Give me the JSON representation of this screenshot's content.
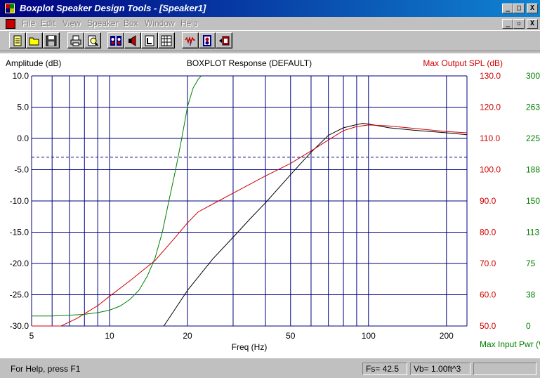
{
  "window": {
    "title": "Boxplot Speaker Design Tools - [Speaker1]",
    "controls": [
      "_",
      "□",
      "X"
    ],
    "doc_controls": [
      "_",
      "▫",
      "X"
    ]
  },
  "menu": [
    "File",
    "Edit",
    "View",
    "Speaker",
    "Box",
    "Window",
    "Help"
  ],
  "toolbar": [
    {
      "name": "new-icon"
    },
    {
      "name": "open-icon"
    },
    {
      "name": "save-icon"
    },
    {
      "name": "print-icon"
    },
    {
      "name": "print-preview-icon"
    },
    {
      "name": "speaker-params-icon"
    },
    {
      "name": "speaker-icon"
    },
    {
      "name": "box-icon"
    },
    {
      "name": "table-icon"
    },
    {
      "name": "response-icon"
    },
    {
      "name": "ports-icon"
    },
    {
      "name": "enclosure-icon"
    }
  ],
  "colors": {
    "grid": "#000080",
    "amplitude": "#000000",
    "spl": "#d00000",
    "power": "#008000",
    "ref_line": "#000080"
  },
  "status": {
    "help": "For Help, press F1",
    "fs": "Fs= 42.5",
    "vb": "Vb= 1.00ft^3",
    "extra": ""
  },
  "chart_data": {
    "type": "line",
    "title": "BOXPLOT Response (DEFAULT)",
    "xlabel": "Freq (Hz)",
    "ylabel": "Amplitude (dB)",
    "y2label": "Max Output SPL (dB)",
    "y3label": "Max Input Pwr (W",
    "xscale": "log",
    "xlim": [
      5,
      240
    ],
    "x_ticks": [
      5,
      10,
      20,
      50,
      100,
      200
    ],
    "x_ticklabels": [
      "5",
      "10",
      "20",
      "50",
      "100",
      "200"
    ],
    "x_gridlines": [
      5,
      6,
      7,
      8,
      9,
      10,
      20,
      30,
      40,
      50,
      60,
      70,
      80,
      90,
      100,
      200
    ],
    "ylim": [
      -30,
      10
    ],
    "y_ticks": [
      10,
      5,
      0,
      -5,
      -10,
      -15,
      -20,
      -25,
      -30
    ],
    "y_ticklabels": [
      "10.0",
      "5.0",
      "0.0",
      "-5.0",
      "-10.0",
      "-15.0",
      "-20.0",
      "-25.0",
      "-30.0"
    ],
    "y2_ticklabels": [
      "130.0",
      "120.0",
      "110.0",
      "100.0",
      "90.0",
      "80.0",
      "70.0",
      "60.0",
      "50.0"
    ],
    "y3_ticklabels": [
      "300",
      "263",
      "225",
      "188",
      "150",
      "113",
      "75",
      "38",
      "0"
    ],
    "reference_line_y": -3,
    "grid": true,
    "series": [
      {
        "name": "Amplitude (dB)",
        "axis": "left",
        "x": [
          16.2,
          20,
          25,
          30,
          35,
          40,
          50,
          60,
          70,
          80,
          90,
          95,
          100,
          110,
          120,
          150,
          200,
          240
        ],
        "y": [
          -30,
          -24.3,
          -19.3,
          -15.8,
          -12.8,
          -10.3,
          -5.8,
          -2.2,
          0.5,
          1.7,
          2.2,
          2.4,
          2.3,
          2.0,
          1.7,
          1.3,
          0.9,
          0.6
        ]
      },
      {
        "name": "Max Output SPL (dB)",
        "axis": "y2",
        "x": [
          5,
          6.5,
          7.5,
          9,
          10,
          12,
          15,
          18,
          20,
          22,
          25,
          30,
          40,
          50,
          60,
          70,
          80,
          90,
          100,
          120,
          150,
          200,
          240
        ],
        "y": [
          50,
          50,
          52.5,
          56.5,
          59.5,
          64.5,
          71,
          78.5,
          83,
          86.5,
          89,
          92.5,
          98,
          102,
          106,
          109.5,
          112.5,
          113.8,
          114.3,
          114,
          113.2,
          112.2,
          111.8
        ]
      },
      {
        "name": "Max Input Pwr (W)",
        "axis": "y3",
        "x": [
          5,
          6,
          7,
          8,
          9,
          10,
          11,
          12,
          13,
          14,
          15,
          16,
          17,
          18,
          19,
          20,
          21,
          22,
          22.6
        ],
        "y": [
          12,
          12,
          13,
          14,
          16,
          19,
          24,
          32,
          43,
          60,
          82,
          113,
          152,
          188,
          225,
          263,
          285,
          296,
          300
        ]
      }
    ]
  }
}
